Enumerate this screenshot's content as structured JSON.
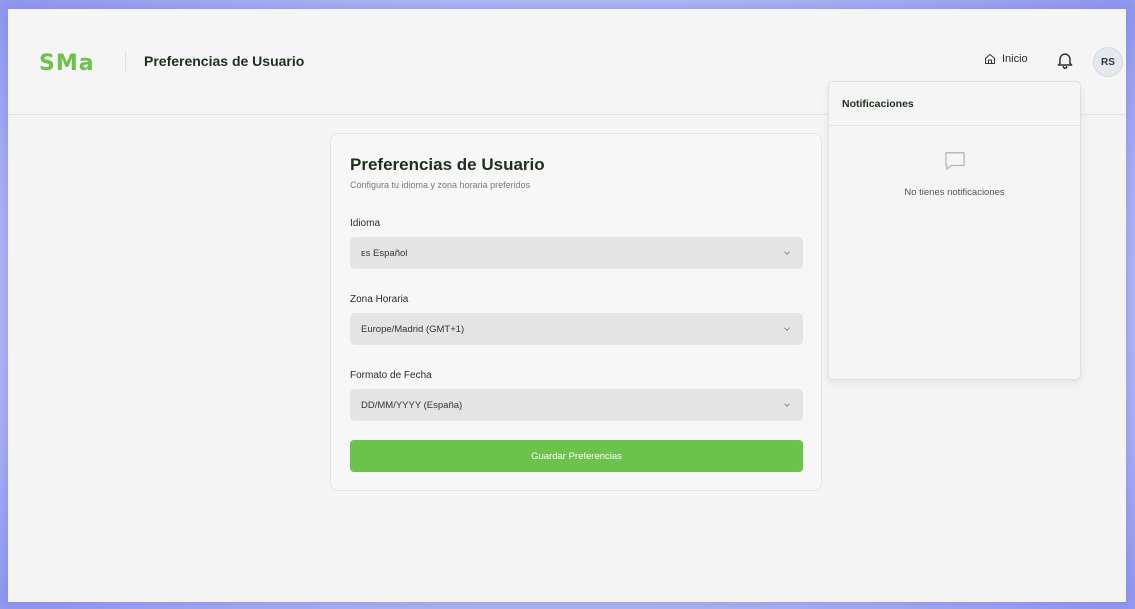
{
  "app": {
    "logo_text": "SMa",
    "page_title": "Preferencias de Usuario"
  },
  "nav": {
    "home_label": "Inicio",
    "avatar_initials": "RS"
  },
  "form": {
    "title": "Preferencias de Usuario",
    "subtitle": "Configura tu idioma y zona horaria preferidos",
    "language": {
      "label": "Idioma",
      "value": "ᴇs Español"
    },
    "timezone": {
      "label": "Zona Horaria",
      "value": "Europe/Madrid (GMT+1)"
    },
    "date_format": {
      "label": "Formato de Fecha",
      "value": "DD/MM/YYYY (España)"
    },
    "save_label": "Guardar Preferencias"
  },
  "notifications": {
    "title": "Notificaciones",
    "empty_text": "No tienes notificaciones"
  },
  "colors": {
    "accent": "#6cc24a",
    "title_text": "#1f2e1f",
    "select_bg": "#e4e4e4"
  },
  "icons": {
    "home": "home-icon",
    "bell": "bell-icon",
    "chevron": "chevron-down-icon",
    "chat": "chat-bubble-icon"
  }
}
